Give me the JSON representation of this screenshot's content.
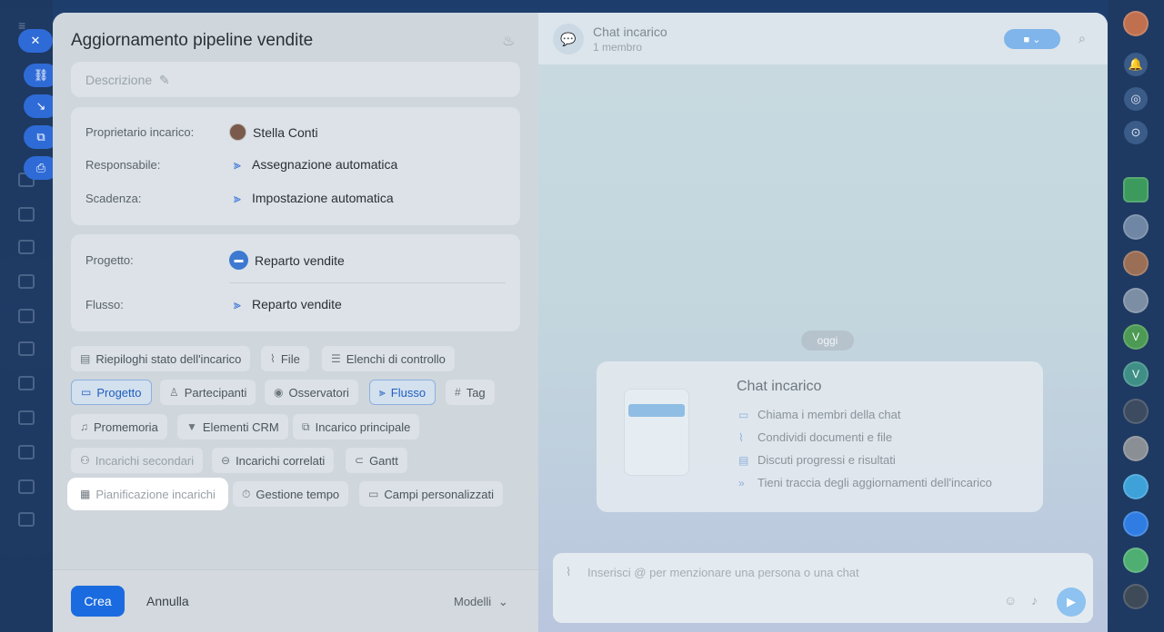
{
  "task": {
    "title": "Aggiornamento pipeline vendite",
    "description_placeholder": "Descrizione",
    "owner_label": "Proprietario incarico:",
    "owner_value": "Stella Conti",
    "responsible_label": "Responsabile:",
    "responsible_value": "Assegnazione automatica",
    "deadline_label": "Scadenza:",
    "deadline_value": "Impostazione automatica",
    "project_label": "Progetto:",
    "project_value": "Reparto vendite",
    "flow_label": "Flusso:",
    "flow_value": "Reparto vendite"
  },
  "chips": {
    "riepiloghi": "Riepiloghi stato dell'incarico",
    "file": "File",
    "elenchi": "Elenchi di controllo",
    "progetto": "Progetto",
    "partecipanti": "Partecipanti",
    "osservatori": "Osservatori",
    "flusso": "Flusso",
    "tag": "Tag",
    "promemoria": "Promemoria",
    "crm": "Elementi CRM",
    "principale": "Incarico principale",
    "secondari": "Incarichi secondari",
    "correlati": "Incarichi correlati",
    "gantt": "Gantt",
    "pianificazione": "Pianificazione incarichi",
    "tempo": "Gestione tempo",
    "campi": "Campi personalizzati"
  },
  "footer": {
    "create": "Crea",
    "cancel": "Annulla",
    "templates": "Modelli"
  },
  "chat": {
    "title": "Chat incarico",
    "members": "1 membro",
    "day": "oggi",
    "info_title": "Chat incarico",
    "items": [
      "Chiama i membri della chat",
      "Condividi documenti e file",
      "Discuti progressi e risultati",
      "Tieni traccia degli aggiornamenti dell'incarico"
    ],
    "input_placeholder": "Inserisci @ per menzionare una persona o una chat"
  },
  "right_avatars": [
    "V",
    "V"
  ],
  "colors": {
    "accent": "#1b6be0",
    "selected_chip": "#d3e0ee"
  }
}
